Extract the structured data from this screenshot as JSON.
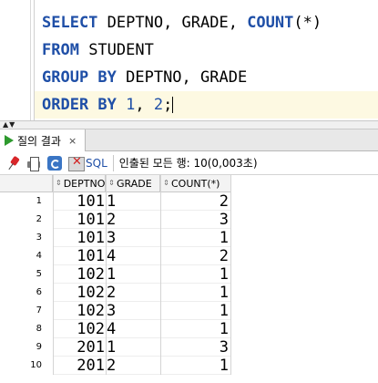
{
  "editor": {
    "lines": [
      [
        {
          "t": "SELECT",
          "c": "kw"
        },
        {
          "t": " DEPTNO, GRADE, ",
          "c": ""
        },
        {
          "t": "COUNT",
          "c": "kw"
        },
        {
          "t": "(*)",
          "c": ""
        }
      ],
      [
        {
          "t": "FROM",
          "c": "kw"
        },
        {
          "t": " STUDENT",
          "c": ""
        }
      ],
      [
        {
          "t": "GROUP BY",
          "c": "kw"
        },
        {
          "t": " DEPTNO, GRADE",
          "c": ""
        }
      ],
      [
        {
          "t": "ORDER BY",
          "c": "kw"
        },
        {
          "t": " ",
          "c": ""
        },
        {
          "t": "1",
          "c": "num"
        },
        {
          "t": ", ",
          "c": ""
        },
        {
          "t": "2",
          "c": "num"
        },
        {
          "t": ";",
          "c": ""
        }
      ]
    ]
  },
  "results_tab": {
    "label": "질의 결과",
    "close": "×"
  },
  "toolbar": {
    "icons": [
      "pin-icon",
      "print-icon",
      "refresh-icon",
      "cancel-icon"
    ],
    "sql_label": "SQL",
    "status": "인출된 모든 행: 10(0,003초)"
  },
  "grid": {
    "columns": [
      "DEPTNO",
      "GRADE",
      "COUNT(*)"
    ],
    "rows": [
      {
        "n": "1",
        "deptno": "101",
        "grade": "1",
        "count": "2"
      },
      {
        "n": "2",
        "deptno": "101",
        "grade": "2",
        "count": "3"
      },
      {
        "n": "3",
        "deptno": "101",
        "grade": "3",
        "count": "1"
      },
      {
        "n": "4",
        "deptno": "101",
        "grade": "4",
        "count": "2"
      },
      {
        "n": "5",
        "deptno": "102",
        "grade": "1",
        "count": "1"
      },
      {
        "n": "6",
        "deptno": "102",
        "grade": "2",
        "count": "1"
      },
      {
        "n": "7",
        "deptno": "102",
        "grade": "3",
        "count": "1"
      },
      {
        "n": "8",
        "deptno": "102",
        "grade": "4",
        "count": "1"
      },
      {
        "n": "9",
        "deptno": "201",
        "grade": "1",
        "count": "3"
      },
      {
        "n": "10",
        "deptno": "201",
        "grade": "2",
        "count": "1"
      }
    ]
  },
  "colors": {
    "keyword": "#1f4fa7",
    "current_line": "#fdf9e2",
    "run_icon": "#2e9a2e"
  }
}
